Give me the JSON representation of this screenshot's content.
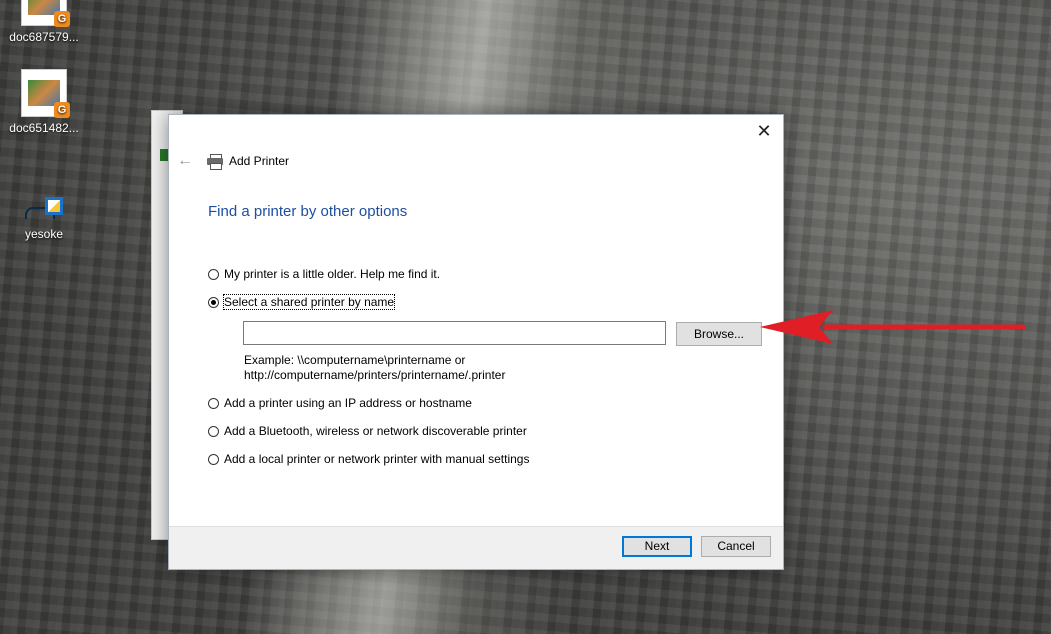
{
  "desktop": {
    "icons": [
      {
        "label": "doc687579..."
      },
      {
        "label": "doc651482..."
      },
      {
        "label": "yesoke"
      }
    ]
  },
  "dialog": {
    "close_glyph": "✕",
    "back_glyph": "←",
    "header_title": "Add Printer",
    "page_title": "Find a printer by other options",
    "options": [
      {
        "label": "My printer is a little older. Help me find it.",
        "selected": false
      },
      {
        "label": "Select a shared printer by name",
        "selected": true
      },
      {
        "label": "Add a printer using an IP address or hostname",
        "selected": false
      },
      {
        "label": "Add a Bluetooth, wireless or network discoverable printer",
        "selected": false
      },
      {
        "label": "Add a local printer or network printer with manual settings",
        "selected": false
      }
    ],
    "shared_name_value": "",
    "browse_label": "Browse...",
    "example_line1": "Example: \\\\computername\\printername or",
    "example_line2": "http://computername/printers/printername/.printer",
    "next_label": "Next",
    "cancel_label": "Cancel"
  },
  "annotation": {
    "arrow_color": "#e01e26"
  },
  "colors": {
    "title_blue": "#1e4fa0",
    "focus_blue": "#0078d7"
  }
}
